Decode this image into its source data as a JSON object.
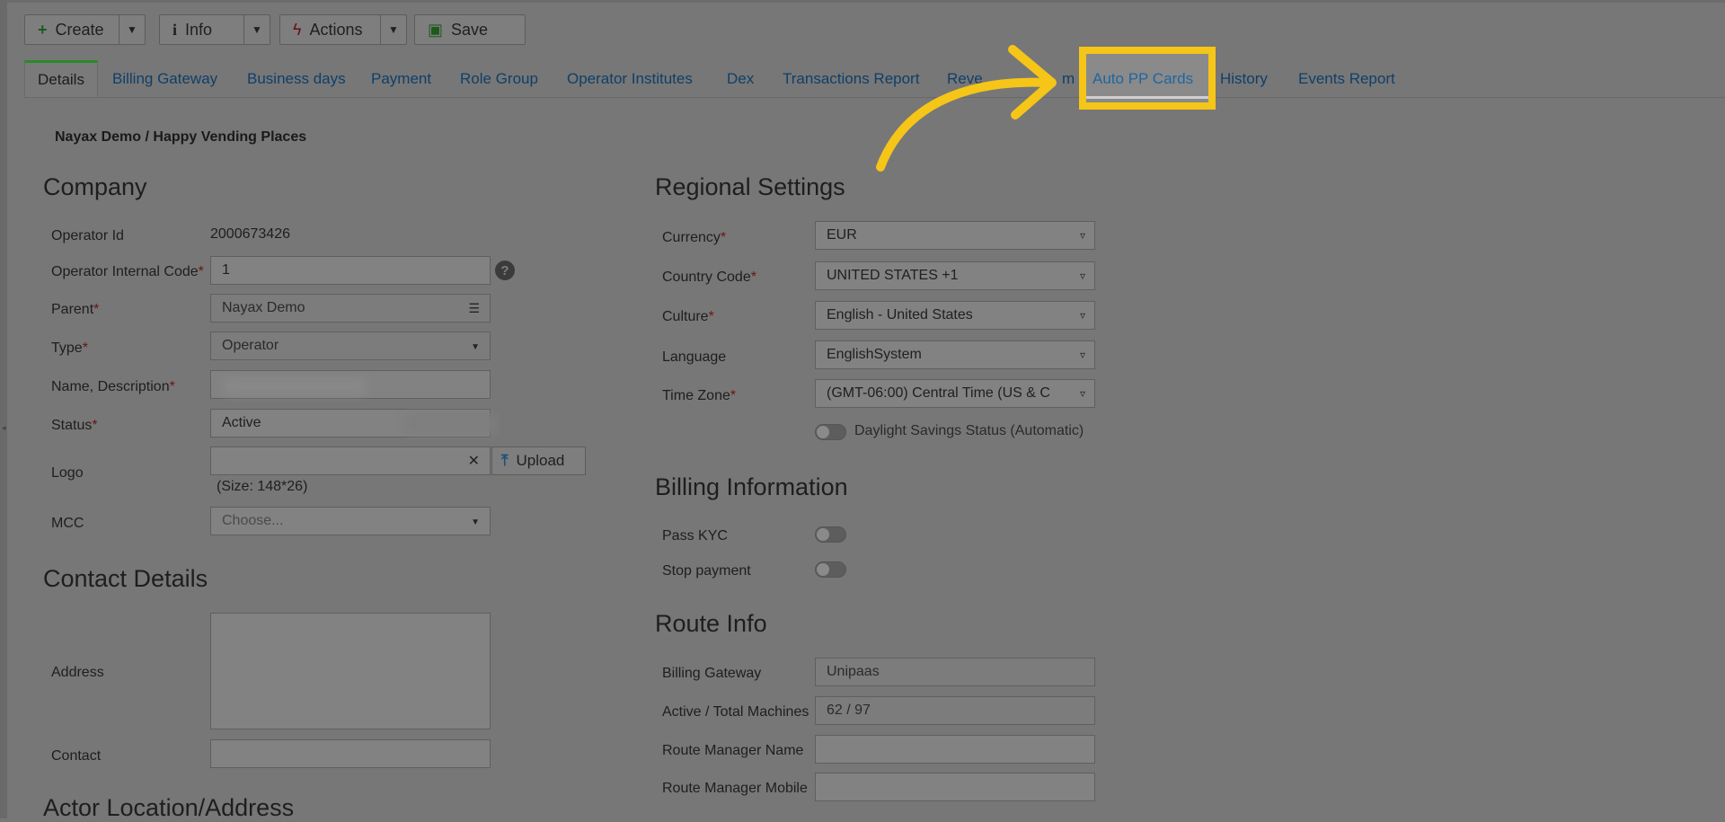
{
  "toolbar": {
    "create_label": "Create",
    "info_label": "Info",
    "actions_label": "Actions",
    "save_label": "Save"
  },
  "tabs": [
    {
      "label": "Details",
      "active": true
    },
    {
      "label": "Billing Gateway"
    },
    {
      "label": "Business days"
    },
    {
      "label": "Payment"
    },
    {
      "label": "Role Group"
    },
    {
      "label": "Operator Institutes"
    },
    {
      "label": "Dex"
    },
    {
      "label": "Transactions Report"
    },
    {
      "label": "Reve"
    },
    {
      "label": "m"
    },
    {
      "label": "Auto PP Cards",
      "highlighted": true
    },
    {
      "label": "History"
    },
    {
      "label": "Events Report"
    }
  ],
  "breadcrumb": "Nayax Demo / Happy Vending Places",
  "company": {
    "title": "Company",
    "operator_id_label": "Operator Id",
    "operator_id": "2000673426",
    "internal_code_label": "Operator Internal Code",
    "internal_code": "1",
    "parent_label": "Parent",
    "parent": "Nayax Demo",
    "type_label": "Type",
    "type": "Operator",
    "name_label": "Name, Description",
    "status_label": "Status",
    "status": "Active",
    "logo_label": "Logo",
    "upload_label": "Upload",
    "logo_size": "(Size: 148*26)",
    "mcc_label": "MCC",
    "mcc_placeholder": "Choose..."
  },
  "contact": {
    "title": "Contact Details",
    "address_label": "Address",
    "contact_label": "Contact"
  },
  "actor_location_title": "Actor Location/Address",
  "regional": {
    "title": "Regional Settings",
    "currency_label": "Currency",
    "currency": "EUR",
    "country_label": "Country Code",
    "country": "UNITED STATES +1",
    "culture_label": "Culture",
    "culture": "English - United States",
    "language_label": "Language",
    "language": "EnglishSystem",
    "timezone_label": "Time Zone",
    "timezone": "(GMT-06:00) Central Time (US & C",
    "dst_label": "Daylight Savings Status (Automatic)"
  },
  "billing": {
    "title": "Billing Information",
    "kyc_label": "Pass KYC",
    "stop_label": "Stop payment"
  },
  "route": {
    "title": "Route Info",
    "gateway_label": "Billing Gateway",
    "gateway": "Unipaas",
    "machines_label": "Active / Total Machines",
    "machines": "62 / 97",
    "manager_name_label": "Route Manager Name",
    "manager_mobile_label": "Route Manager Mobile"
  },
  "colors": {
    "highlight": "#f5c518",
    "overlay_gray": "#777777",
    "link_blue": "#0f3f68"
  }
}
